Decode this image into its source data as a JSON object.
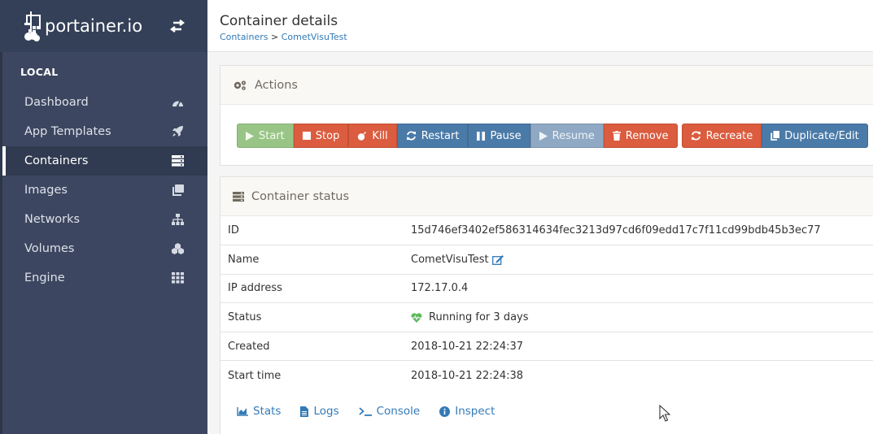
{
  "brand": {
    "name": "portainer.io"
  },
  "sidebar": {
    "section": "LOCAL",
    "items": [
      {
        "label": "Dashboard",
        "icon": "dashboard-icon"
      },
      {
        "label": "App Templates",
        "icon": "rocket-icon"
      },
      {
        "label": "Containers",
        "icon": "server-icon",
        "active": true
      },
      {
        "label": "Images",
        "icon": "clone-icon"
      },
      {
        "label": "Networks",
        "icon": "sitemap-icon"
      },
      {
        "label": "Volumes",
        "icon": "cubes-icon"
      },
      {
        "label": "Engine",
        "icon": "th-icon"
      }
    ]
  },
  "header": {
    "title": "Container details",
    "breadcrumb": {
      "link": "Containers",
      "separator": ">",
      "current": "CometVisuTest"
    }
  },
  "actions": {
    "title": "Actions",
    "buttons": {
      "start": "Start",
      "stop": "Stop",
      "kill": "Kill",
      "restart": "Restart",
      "pause": "Pause",
      "resume": "Resume",
      "remove": "Remove",
      "recreate": "Recreate",
      "duplicate": "Duplicate/Edit"
    }
  },
  "status": {
    "title": "Container status",
    "rows": [
      {
        "key": "ID",
        "value": "15d746ef3402ef586314634fec3213d97cd6f09edd17c7f11cd99bdb45b3ec77"
      },
      {
        "key": "Name",
        "value": "CometVisuTest"
      },
      {
        "key": "IP address",
        "value": "172.17.0.4"
      },
      {
        "key": "Status",
        "value": "Running for 3 days"
      },
      {
        "key": "Created",
        "value": "2018-10-21 22:24:37"
      },
      {
        "key": "Start time",
        "value": "2018-10-21 22:24:38"
      }
    ],
    "links": {
      "stats": "Stats",
      "logs": "Logs",
      "console": "Console",
      "inspect": "Inspect"
    }
  },
  "colors": {
    "sidebar": "#3c4660",
    "danger": "#db5c3e",
    "primary": "#4a7aa8",
    "success": "#98c585",
    "running": "#5cb85c",
    "link": "#337ab7"
  }
}
